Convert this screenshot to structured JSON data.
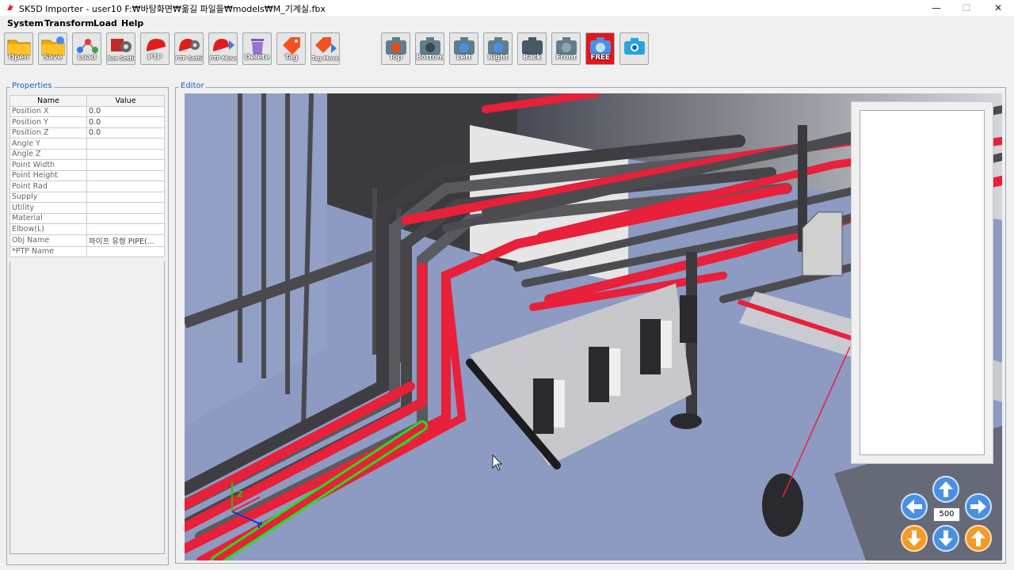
{
  "window": {
    "title": "SK5D Importer - user10 F:₩바탕화면₩옮길 파일들₩models₩M_기계실.fbx",
    "minimize": "—",
    "maximize": "☐",
    "close": "✕"
  },
  "menu": [
    "System",
    "Transform",
    "Load",
    "Help"
  ],
  "toolbar": {
    "left": [
      {
        "label": "Open",
        "icon": "folder-icon",
        "small": false
      },
      {
        "label": "Save",
        "icon": "save-folder-icon",
        "small": false
      },
      {
        "label": "Load",
        "icon": "network-load-icon",
        "small": false
      },
      {
        "label": "Box Setting",
        "icon": "box-setting-icon",
        "small": true
      },
      {
        "label": "PTP",
        "icon": "ptp-pin-icon",
        "small": false
      },
      {
        "label": "PTP Setting",
        "icon": "ptp-setting-icon",
        "small": true
      },
      {
        "label": "PTP Move",
        "icon": "ptp-move-icon",
        "small": true
      },
      {
        "label": "Delete",
        "icon": "trash-icon",
        "small": false
      },
      {
        "label": "Tag",
        "icon": "tag-icon",
        "small": false
      },
      {
        "label": "Tag Move",
        "icon": "tag-move-icon",
        "small": true
      }
    ],
    "views": [
      {
        "label": "Top",
        "icon": "camera-top-icon"
      },
      {
        "label": "Bottom",
        "icon": "camera-bottom-icon"
      },
      {
        "label": "Left",
        "icon": "camera-left-icon"
      },
      {
        "label": "Right",
        "icon": "camera-right-icon"
      },
      {
        "label": "Back",
        "icon": "camera-back-icon"
      },
      {
        "label": "Front",
        "icon": "camera-front-icon"
      },
      {
        "label": "FREE",
        "icon": "camera-free-icon"
      },
      {
        "label": "",
        "icon": "camera-screenshot-icon"
      }
    ]
  },
  "properties": {
    "group_title": "Properties",
    "columns": [
      "Name",
      "Value"
    ],
    "rows": [
      {
        "name": "Position X",
        "value": "0.0"
      },
      {
        "name": "Position Y",
        "value": "0.0"
      },
      {
        "name": "Position Z",
        "value": "0.0"
      },
      {
        "name": "Angle Y",
        "value": ""
      },
      {
        "name": "Angle Z",
        "value": ""
      },
      {
        "name": "Point Width",
        "value": ""
      },
      {
        "name": "Point Height",
        "value": ""
      },
      {
        "name": "Point Rad",
        "value": ""
      },
      {
        "name": "Supply",
        "value": ""
      },
      {
        "name": "Utility",
        "value": ""
      },
      {
        "name": "Material",
        "value": ""
      },
      {
        "name": "Elbow(L)",
        "value": ""
      },
      {
        "name": "Obj Name",
        "value": "파이프 유형 PIPE(..."
      },
      {
        "name": "*PTP Name",
        "value": ""
      }
    ]
  },
  "editor": {
    "group_title": "Editor",
    "axis_labels": {
      "z": "Z",
      "y": "Y"
    },
    "zoom_step": "500",
    "nav_icons": [
      "arrow-up-icon",
      "arrow-left-icon",
      "arrow-right-icon",
      "arrow-down-orange-icon",
      "arrow-down-icon",
      "arrow-up-orange-icon"
    ]
  },
  "colors": {
    "viewport_bg": "#8d9bc2",
    "pipe_red": "#e8203a",
    "pipe_gray": "#5a5a5e",
    "highlight_green": "#22e01e",
    "free_button": "#e8141c",
    "group_title_blue": "#1f5fbf"
  }
}
